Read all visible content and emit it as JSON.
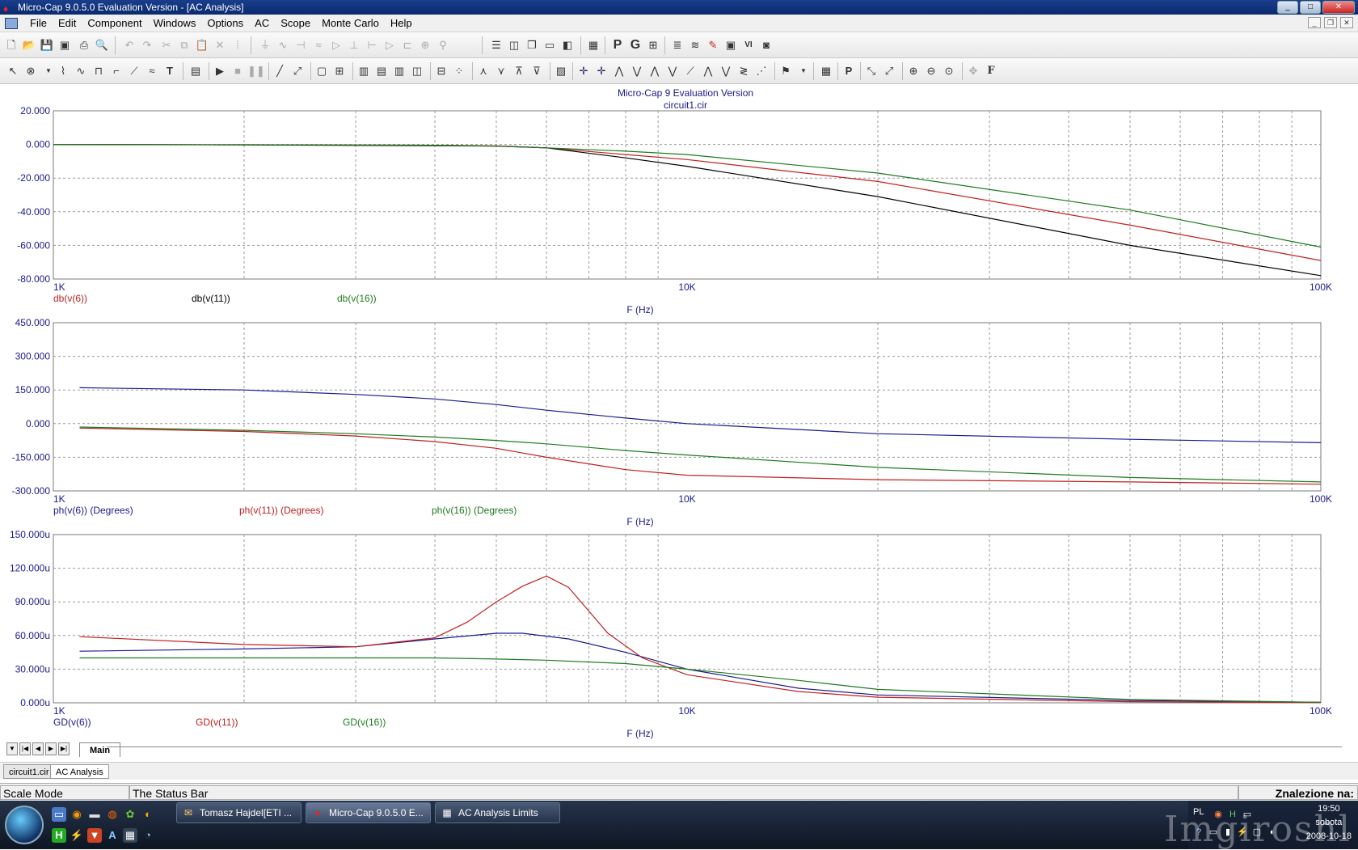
{
  "window": {
    "title": "Micro-Cap 9.0.5.0 Evaluation Version - [AC Analysis]"
  },
  "menu": {
    "items": [
      "File",
      "Edit",
      "Component",
      "Windows",
      "Options",
      "AC",
      "Scope",
      "Monte Carlo",
      "Help"
    ]
  },
  "plot_header": {
    "line1": "Micro-Cap 9 Evaluation Version",
    "line2": "circuit1.cir"
  },
  "chart_data": [
    {
      "type": "line",
      "xscale": "log",
      "xlim": [
        1000,
        100000
      ],
      "ylim": [
        -80,
        20
      ],
      "yticks": [
        "20.000",
        "0.000",
        "-20.000",
        "-40.000",
        "-60.000",
        "-80.000"
      ],
      "xticks": [
        "1K",
        "10K",
        "100K"
      ],
      "xlabel": "F (Hz)",
      "grid": true,
      "series": [
        {
          "name": "db(v(6))",
          "color": "#c02020",
          "x": [
            1000,
            2000,
            4000,
            5000,
            6000,
            8000,
            10000,
            20000,
            50000,
            100000
          ],
          "values": [
            0,
            -0.2,
            -0.5,
            -0.8,
            -2,
            -6,
            -9,
            -22,
            -48,
            -69
          ]
        },
        {
          "name": "db(v(11))",
          "color": "#000000",
          "x": [
            1000,
            2000,
            4000,
            5000,
            6000,
            8000,
            10000,
            20000,
            50000,
            100000
          ],
          "values": [
            0,
            -0.3,
            -0.7,
            -1,
            -2,
            -8,
            -13,
            -31,
            -60,
            -78
          ]
        },
        {
          "name": "db(v(16))",
          "color": "#1e7a1e",
          "x": [
            1000,
            2000,
            4000,
            5000,
            6000,
            8000,
            10000,
            20000,
            50000,
            100000
          ],
          "values": [
            0,
            -0.2,
            -0.5,
            -1,
            -2,
            -4,
            -6,
            -17,
            -39,
            -61
          ]
        }
      ]
    },
    {
      "type": "line",
      "xscale": "log",
      "xlim": [
        1000,
        100000
      ],
      "ylim": [
        -300,
        450
      ],
      "yticks": [
        "450.000",
        "300.000",
        "150.000",
        "0.000",
        "-150.000",
        "-300.000"
      ],
      "xticks": [
        "1K",
        "10K",
        "100K"
      ],
      "xlabel": "F (Hz)",
      "grid": true,
      "series": [
        {
          "name": "ph(v(6)) (Degrees)",
          "color": "#1a1a8c",
          "x": [
            1100,
            2000,
            3000,
            4000,
            5000,
            6000,
            8000,
            10000,
            20000,
            50000,
            100000
          ],
          "values": [
            160,
            150,
            130,
            110,
            85,
            60,
            25,
            0,
            -45,
            -70,
            -85
          ]
        },
        {
          "name": "ph(v(11)) (Degrees)",
          "color": "#c02020",
          "x": [
            1100,
            2000,
            3000,
            4000,
            5000,
            6000,
            8000,
            10000,
            20000,
            50000,
            100000
          ],
          "values": [
            -20,
            -35,
            -55,
            -80,
            -110,
            -150,
            -205,
            -230,
            -250,
            -260,
            -270
          ]
        },
        {
          "name": "ph(v(16)) (Degrees)",
          "color": "#1e7a1e",
          "x": [
            1100,
            2000,
            3000,
            4000,
            5000,
            6000,
            8000,
            10000,
            20000,
            50000,
            100000
          ],
          "values": [
            -15,
            -30,
            -45,
            -60,
            -75,
            -90,
            -120,
            -140,
            -195,
            -240,
            -260
          ]
        }
      ]
    },
    {
      "type": "line",
      "xscale": "log",
      "xlim": [
        1000,
        100000
      ],
      "ylim": [
        0,
        150
      ],
      "yticks": [
        "150.000u",
        "120.000u",
        "90.000u",
        "60.000u",
        "30.000u",
        "0.000u"
      ],
      "xticks": [
        "1K",
        "10K",
        "100K"
      ],
      "xlabel": "F (Hz)",
      "grid": true,
      "series": [
        {
          "name": "GD(v(6))",
          "color": "#1a1a8c",
          "x": [
            1100,
            2000,
            3000,
            4000,
            5000,
            5500,
            6500,
            8000,
            10000,
            15000,
            20000,
            50000,
            100000
          ],
          "values": [
            46,
            48,
            50,
            57,
            62,
            62,
            57,
            45,
            30,
            13,
            7,
            2,
            0.5
          ]
        },
        {
          "name": "GD(v(11))",
          "color": "#c02020",
          "x": [
            1100,
            2000,
            3000,
            4000,
            4500,
            5000,
            5500,
            6000,
            6500,
            7500,
            8500,
            10000,
            15000,
            20000,
            50000,
            100000
          ],
          "values": [
            59,
            52,
            50,
            58,
            72,
            90,
            104,
            113,
            103,
            62,
            40,
            25,
            10,
            5,
            1,
            0.2
          ]
        },
        {
          "name": "GD(v(16))",
          "color": "#1e7a1e",
          "x": [
            1100,
            2000,
            3000,
            4000,
            5000,
            6000,
            8000,
            10000,
            15000,
            20000,
            50000,
            100000
          ],
          "values": [
            40,
            40,
            40,
            40,
            39,
            38,
            35,
            30,
            20,
            12,
            3,
            0.5
          ]
        }
      ]
    }
  ],
  "tabs": {
    "sheet": "Main",
    "documents": [
      "circuit1.cir",
      "AC Analysis"
    ]
  },
  "status": {
    "mode": "Scale Mode",
    "text": "The Status Bar",
    "search": "Znalezione na:"
  },
  "taskbar": {
    "tasks": [
      "Tomasz Hajdel[ETI ...",
      "Micro-Cap 9.0.5.0 E...",
      "AC Analysis Limits"
    ],
    "lang": "PL",
    "time": "19:50",
    "day": "sobota",
    "date": "2008-10-18",
    "watermark": "Imgiroshl"
  }
}
